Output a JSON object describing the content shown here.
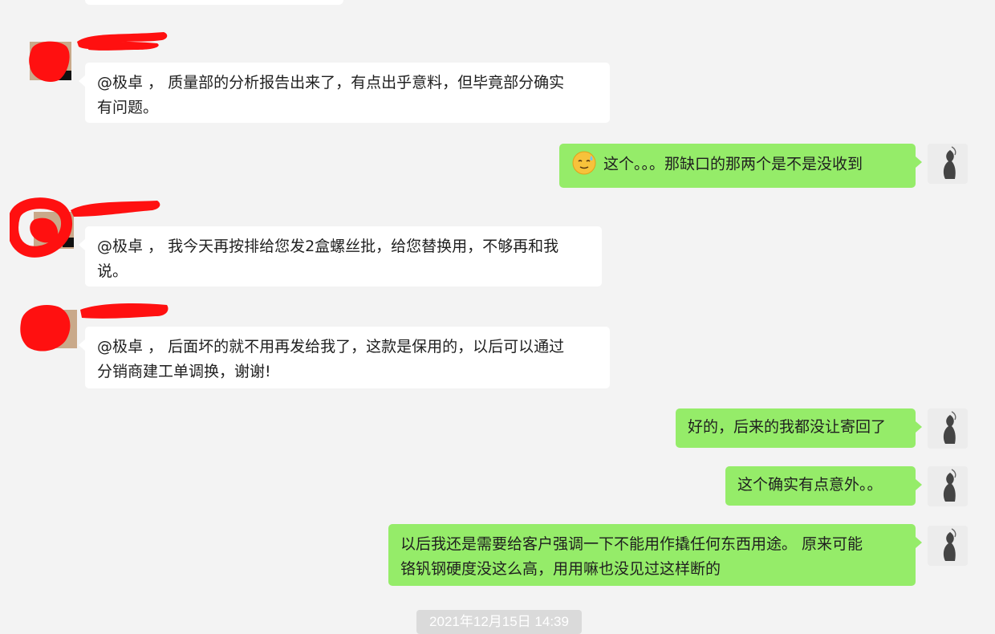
{
  "chat": {
    "messages": [
      {
        "from": "other",
        "text_line1": "@极卓 ， 质量部的分析报告出来了，有点出乎意料，但毕竟部分确实",
        "text_line2": "有问题。"
      },
      {
        "from": "self",
        "emoji": "sweat-smile-emoji",
        "text": "这个。。。那缺口的那两个是不是没收到"
      },
      {
        "from": "other",
        "text_line1": "@极卓 ， 我今天再按排给您发2盒螺丝批，给您替换用，不够再和我",
        "text_line2": "说。"
      },
      {
        "from": "other",
        "text_line1": "@极卓 ， 后面坏的就不用再发给我了，这款是保用的，以后可以通过",
        "text_line2": "分销商建工单调换，谢谢!"
      },
      {
        "from": "self",
        "text": "好的，后来的我都没让寄回了"
      },
      {
        "from": "self",
        "text": "这个确实有点意外。。"
      },
      {
        "from": "self",
        "text_line1": "以后我还是需要给客户强调一下不能用作撬任何东西用途。 原来可能",
        "text_line2": "铬钒钢硬度没这么高，用用嘛也没见过这样断的"
      }
    ],
    "timestamp": "2021年12月15日 14:39"
  },
  "colors": {
    "background": "#f3f3f3",
    "bubble_self": "#95ec69",
    "bubble_other": "#ffffff",
    "redaction": "#ff0000"
  }
}
